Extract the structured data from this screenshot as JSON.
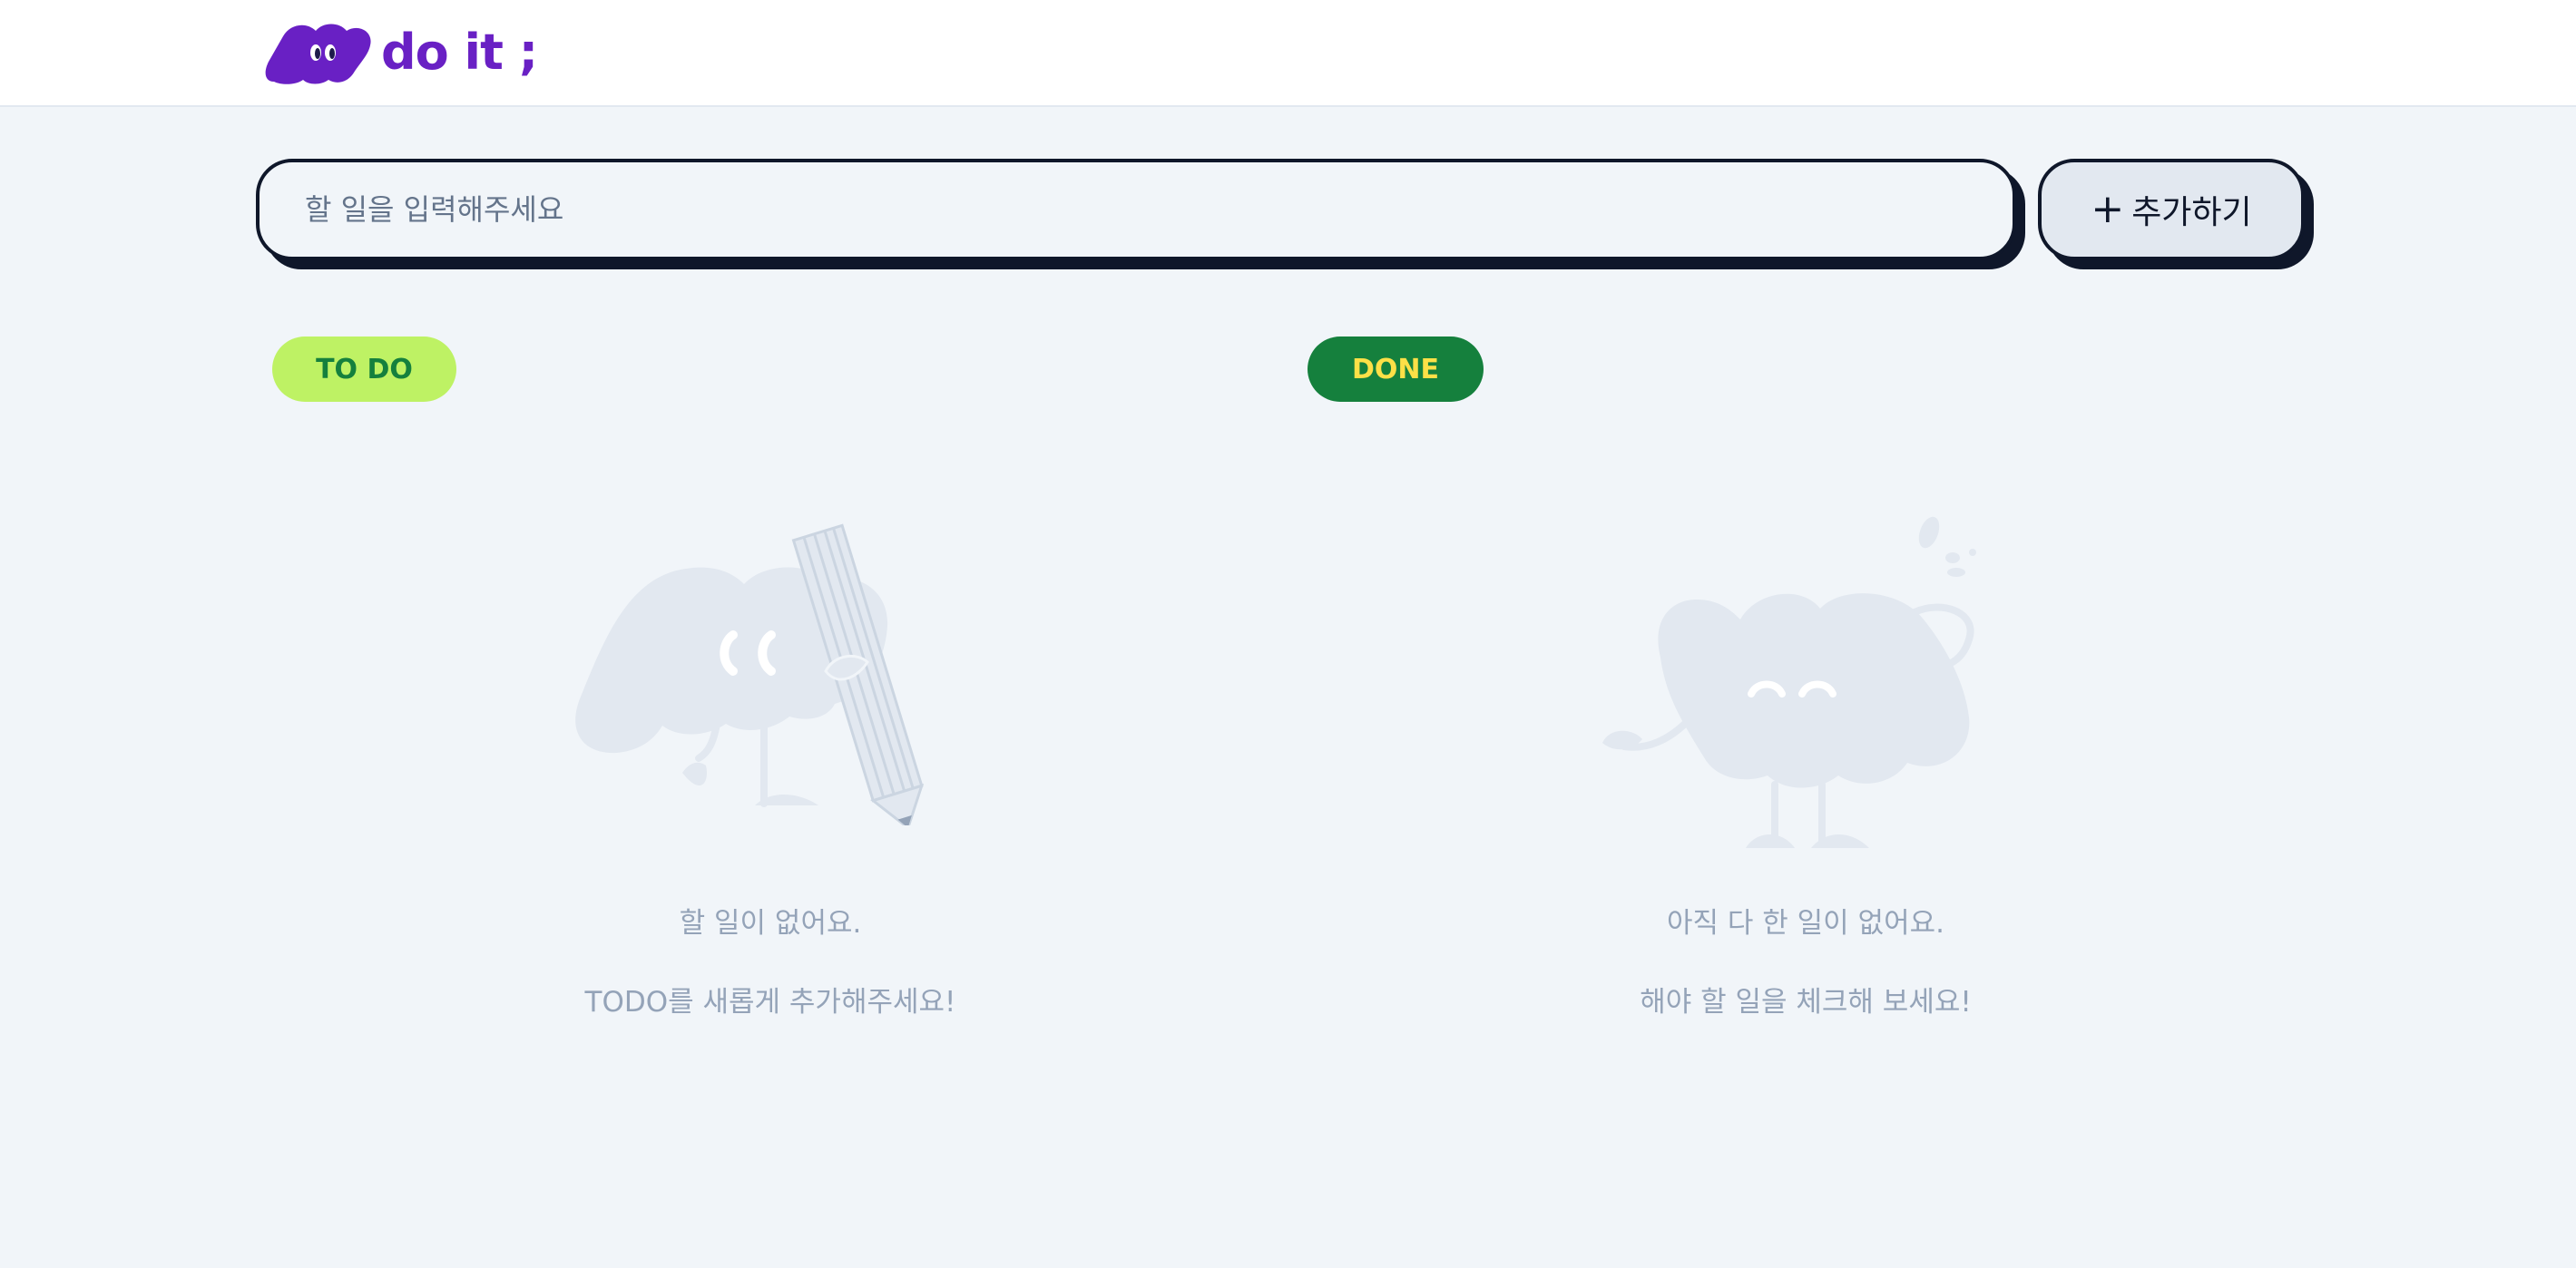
{
  "header": {
    "logo_text": "do it ;",
    "logo_icon": "cloud-face-logo-icon"
  },
  "search": {
    "placeholder": "할 일을 입력해주세요",
    "value": ""
  },
  "add_button": {
    "plus": "+",
    "label": "추가하기"
  },
  "todo_section": {
    "badge": "TO DO",
    "empty_line1": "할 일이 없어요.",
    "empty_line2": "TODO를 새롭게 추가해주세요!",
    "illustration": "cloud-character-with-pencil-icon"
  },
  "done_section": {
    "badge": "DONE",
    "empty_line1": "아직 다 한 일이 없어요.",
    "empty_line2": "해야 할 일을 체크해 보세요!",
    "illustration": "cloud-character-sweating-icon"
  },
  "colors": {
    "brand": "#6920C4",
    "background": "#F1F5F9",
    "todo_badge_bg": "#BEF264",
    "todo_badge_text": "#15803D",
    "done_badge_bg": "#15803D",
    "done_badge_text": "#FDE047",
    "illustration": "#E2E8F0"
  }
}
